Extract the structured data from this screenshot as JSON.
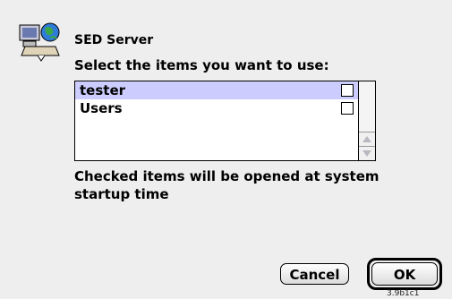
{
  "dialog": {
    "icon": "computer-globe-icon",
    "title": "SED Server",
    "prompt": "Select the items you want to use:",
    "items": [
      {
        "label": "tester",
        "checked": false,
        "selected": true
      },
      {
        "label": "Users",
        "checked": false,
        "selected": false
      }
    ],
    "note": "Checked items will be opened at system startup time",
    "cancel_label": "Cancel",
    "ok_label": "OK",
    "version": "3.9b1c1"
  },
  "colors": {
    "dialog_background": "#eeeeee",
    "selection": "#cccdfe"
  }
}
